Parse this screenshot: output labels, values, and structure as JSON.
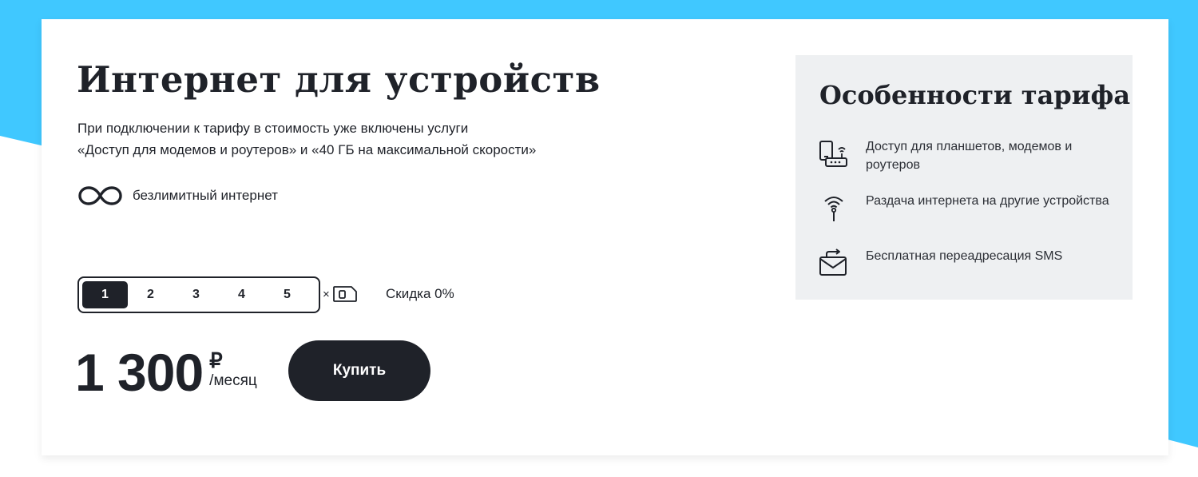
{
  "tariff": {
    "title": "Интернет для устройств",
    "description_lines": [
      "При подключении к тарифу в стоимость уже включены услуги",
      "«Доступ для модемов и роутеров» и «40 ГБ на максимальной скорости»"
    ],
    "unlimited_label": "безлимитный интернет",
    "unlimited_icon": "infinity-icon"
  },
  "selector": {
    "options": [
      "1",
      "2",
      "3",
      "4",
      "5"
    ],
    "selected": "1",
    "multiplier": "×",
    "sim_icon": "sim-card-icon",
    "discount": "Скидка 0%"
  },
  "price": {
    "amount": "1 300",
    "currency": "₽",
    "period": "/месяц"
  },
  "buy_button": {
    "label": "Купить"
  },
  "features": {
    "title": "Особенности тарифа",
    "items": [
      {
        "icon": "devices-router-icon",
        "text": "Доступ для планшетов, модемов и роутеров"
      },
      {
        "icon": "wifi-hotspot-icon",
        "text": "Раздача интернета на другие устройства"
      },
      {
        "icon": "sms-forward-icon",
        "text": "Бесплатная переадресация SMS"
      }
    ]
  },
  "colors": {
    "background_accent": "#40c8ff",
    "dark": "#1f2229",
    "panel": "#eef0f2"
  }
}
